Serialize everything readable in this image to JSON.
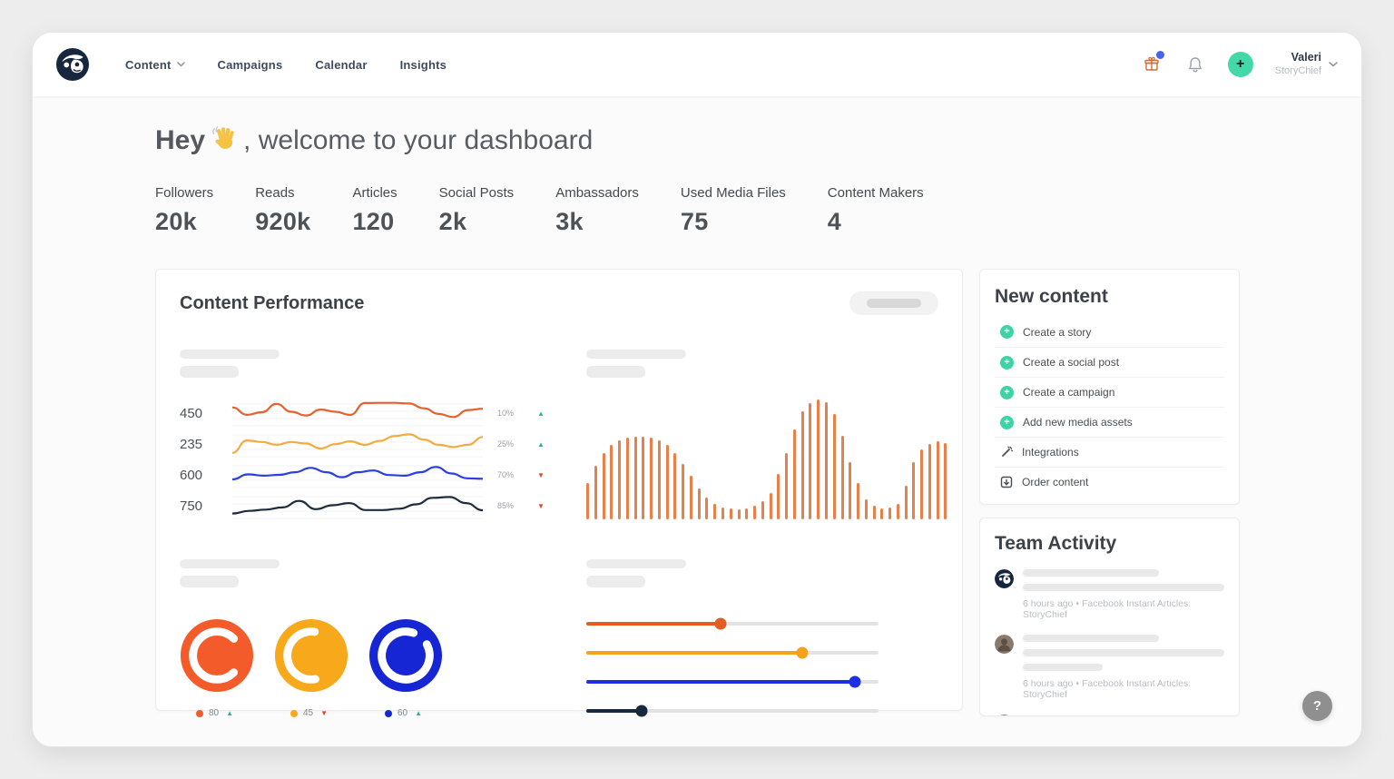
{
  "nav": {
    "items": [
      {
        "label": "Content",
        "has_dropdown": true
      },
      {
        "label": "Campaigns"
      },
      {
        "label": "Calendar"
      },
      {
        "label": "Insights"
      }
    ],
    "user": {
      "name": "Valeri",
      "org": "StoryChief"
    }
  },
  "hero": {
    "greeting_bold": "Hey",
    "greeting_rest": ", welcome to your dashboard"
  },
  "stats": [
    {
      "label": "Followers",
      "value": "20k"
    },
    {
      "label": "Reads",
      "value": "920k"
    },
    {
      "label": "Articles",
      "value": "120"
    },
    {
      "label": "Social Posts",
      "value": "2k"
    },
    {
      "label": "Ambassadors",
      "value": "3k"
    },
    {
      "label": "Used Media Files",
      "value": "75"
    },
    {
      "label": "Content Makers",
      "value": "4"
    }
  ],
  "performance": {
    "title": "Content Performance",
    "sparklines": [
      {
        "value": "450",
        "change": "10%",
        "direction": "up",
        "color": "#e6602e",
        "points": [
          0.72,
          0.38,
          0.5,
          0.88,
          0.52,
          0.35,
          0.62,
          0.52,
          0.38,
          0.92,
          0.93,
          0.93,
          0.9,
          0.68,
          0.42,
          0.28,
          0.6,
          0.66
        ]
      },
      {
        "value": "235",
        "change": "25%",
        "direction": "up",
        "color": "#f2ab3f",
        "points": [
          0.05,
          0.62,
          0.55,
          0.42,
          0.55,
          0.48,
          0.25,
          0.45,
          0.58,
          0.42,
          0.6,
          0.82,
          0.9,
          0.66,
          0.42,
          0.32,
          0.42,
          0.78
        ]
      },
      {
        "value": "600",
        "change": "70%",
        "direction": "down",
        "color": "#2b3fe0",
        "points": [
          0.25,
          0.48,
          0.42,
          0.46,
          0.58,
          0.78,
          0.58,
          0.35,
          0.58,
          0.66,
          0.45,
          0.42,
          0.58,
          0.82,
          0.52,
          0.3,
          0.28
        ]
      },
      {
        "value": "750",
        "change": "85%",
        "direction": "down",
        "color": "#1e2d3d",
        "points": [
          0.1,
          0.22,
          0.28,
          0.38,
          0.68,
          0.3,
          0.48,
          0.58,
          0.26,
          0.26,
          0.32,
          0.52,
          0.82,
          0.86,
          0.58,
          0.25
        ]
      }
    ],
    "chart_data": {
      "type": "bar",
      "title": "",
      "xlabel": "",
      "ylabel": "",
      "color": "#e98049",
      "note": "unlabeled decorative bar chart; values are relative heights in %",
      "values": [
        30,
        45,
        55,
        62,
        66,
        68,
        69,
        69,
        68,
        66,
        62,
        55,
        46,
        36,
        26,
        18,
        13,
        10,
        9,
        8,
        9,
        11,
        15,
        22,
        38,
        55,
        75,
        90,
        97,
        100,
        98,
        88,
        70,
        48,
        30,
        17,
        11,
        9,
        10,
        13,
        28,
        48,
        58,
        63,
        65,
        64
      ]
    },
    "donuts": [
      {
        "value": "80",
        "direction": "up",
        "color": "#f35b2a",
        "arc": 0.75,
        "rotate": 45
      },
      {
        "value": "45",
        "direction": "down",
        "color": "#f7a81b",
        "arc": 0.55,
        "rotate": 80
      },
      {
        "value": "60",
        "direction": "up",
        "color": "#1726d4",
        "arc": 0.88,
        "rotate": -28
      }
    ],
    "sliders": [
      {
        "pct": 46,
        "color": "#e75b22"
      },
      {
        "pct": 74,
        "color": "#f5a31b"
      },
      {
        "pct": 92,
        "color": "#1e2ee2"
      },
      {
        "pct": 19,
        "color": "#16283e"
      }
    ],
    "trend_colors": {
      "up": "#28b795",
      "down": "#e2472e"
    }
  },
  "new_content": {
    "title": "New content",
    "accent": "#41d1a7",
    "items": [
      {
        "label": "Create a story",
        "icon": "plus-circle"
      },
      {
        "label": "Create a social post",
        "icon": "plus-circle"
      },
      {
        "label": "Create a campaign",
        "icon": "plus-circle"
      },
      {
        "label": "Add new media assets",
        "icon": "plus-circle"
      },
      {
        "label": "Integrations",
        "icon": "wand"
      },
      {
        "label": "Order content",
        "icon": "order"
      }
    ]
  },
  "team_activity": {
    "title": "Team Activity",
    "items": [
      {
        "avatar": "storychief-logo",
        "meta": "6 hours ago • Facebook Instant Articles: StoryChief"
      },
      {
        "avatar": "user-photo",
        "meta": "6 hours ago • Facebook Instant Articles: StoryChief"
      },
      {
        "avatar": "user-photo",
        "meta": ""
      }
    ]
  },
  "help": {
    "label": "?"
  }
}
